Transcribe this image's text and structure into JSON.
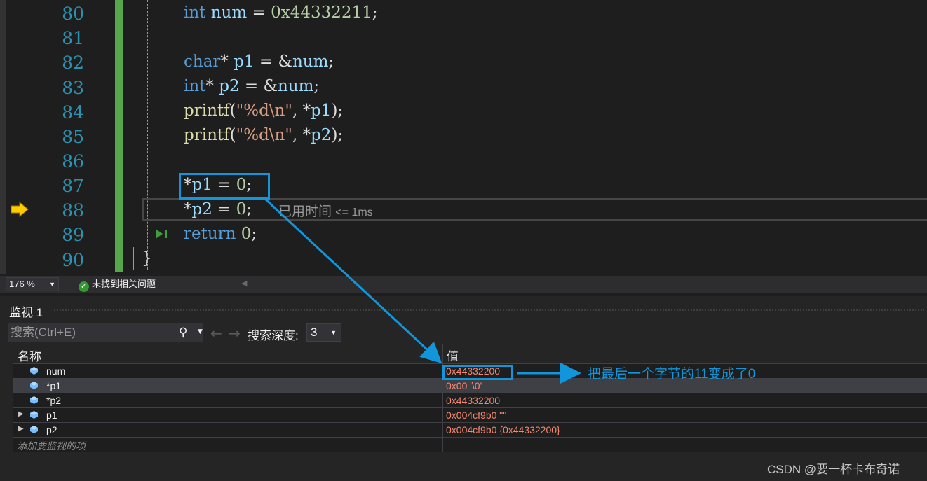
{
  "editor": {
    "line_numbers": [
      "80",
      "81",
      "82",
      "83",
      "84",
      "85",
      "86",
      "87",
      "88",
      "89",
      "90"
    ],
    "lines": {
      "l80": {
        "kw": "int",
        "rest_id": "num",
        "eq": " = ",
        "num": "0x44332211",
        "end": ";"
      },
      "l82": {
        "kw": "char",
        "star": "* ",
        "id": "p1",
        "eq": " = ",
        "amp": "&",
        "id2": "num",
        "end": ";"
      },
      "l83": {
        "kw": "int",
        "star": "* ",
        "id": "p2",
        "eq": " = ",
        "amp": "&",
        "id2": "num",
        "end": ";"
      },
      "l84": {
        "fn": "printf",
        "open": "(",
        "str": "\"%d\\n\"",
        "sep": ", *",
        "id": "p1",
        "close": ");"
      },
      "l85": {
        "fn": "printf",
        "open": "(",
        "str": "\"%d\\n\"",
        "sep": ", *",
        "id": "p2",
        "close": ");"
      },
      "l87": {
        "star": "*",
        "id": "p1",
        "eq": " = ",
        "num": "0",
        "end": ";"
      },
      "l88": {
        "star": "*",
        "id": "p2",
        "eq": " = ",
        "num": "0",
        "end": ";"
      },
      "l89": {
        "kw": "return",
        "num": "0",
        "end": ";"
      },
      "l90": {
        "brace": "}"
      }
    },
    "elapsed_label": "已用时间",
    "elapsed_value": "<= 1ms"
  },
  "statusbar": {
    "zoom": "176 %",
    "issues_text": "未找到相关问题"
  },
  "watch": {
    "title": "监视 1",
    "search_placeholder": "搜索(Ctrl+E)",
    "depth_label": "搜索深度:",
    "depth_value": "3",
    "col_name": "名称",
    "col_value": "值",
    "rows": [
      {
        "name": "num",
        "value": "0x44332200",
        "expandable": false
      },
      {
        "name": "*p1",
        "value": "0x00 '\\0'",
        "expandable": false
      },
      {
        "name": "*p2",
        "value": "0x44332200",
        "expandable": false
      },
      {
        "name": "p1",
        "value": "0x004cf9b0 \"\"",
        "expandable": true
      },
      {
        "name": "p2",
        "value": "0x004cf9b0 {0x44332200}",
        "expandable": true
      }
    ],
    "add_hint": "添加要监视的项"
  },
  "annotation": {
    "text": "把最后一个字节的11变成了0"
  },
  "watermark": "CSDN @要一杯卡布奇诺",
  "colors": {
    "keyword": "#569cd6",
    "identifier": "#9cdcfe",
    "number": "#b5cea8",
    "string": "#d69d85",
    "function": "#dcdcaa",
    "watch_value": "#f48771",
    "annotation": "#1296db",
    "change_bar": "#57a64a"
  }
}
